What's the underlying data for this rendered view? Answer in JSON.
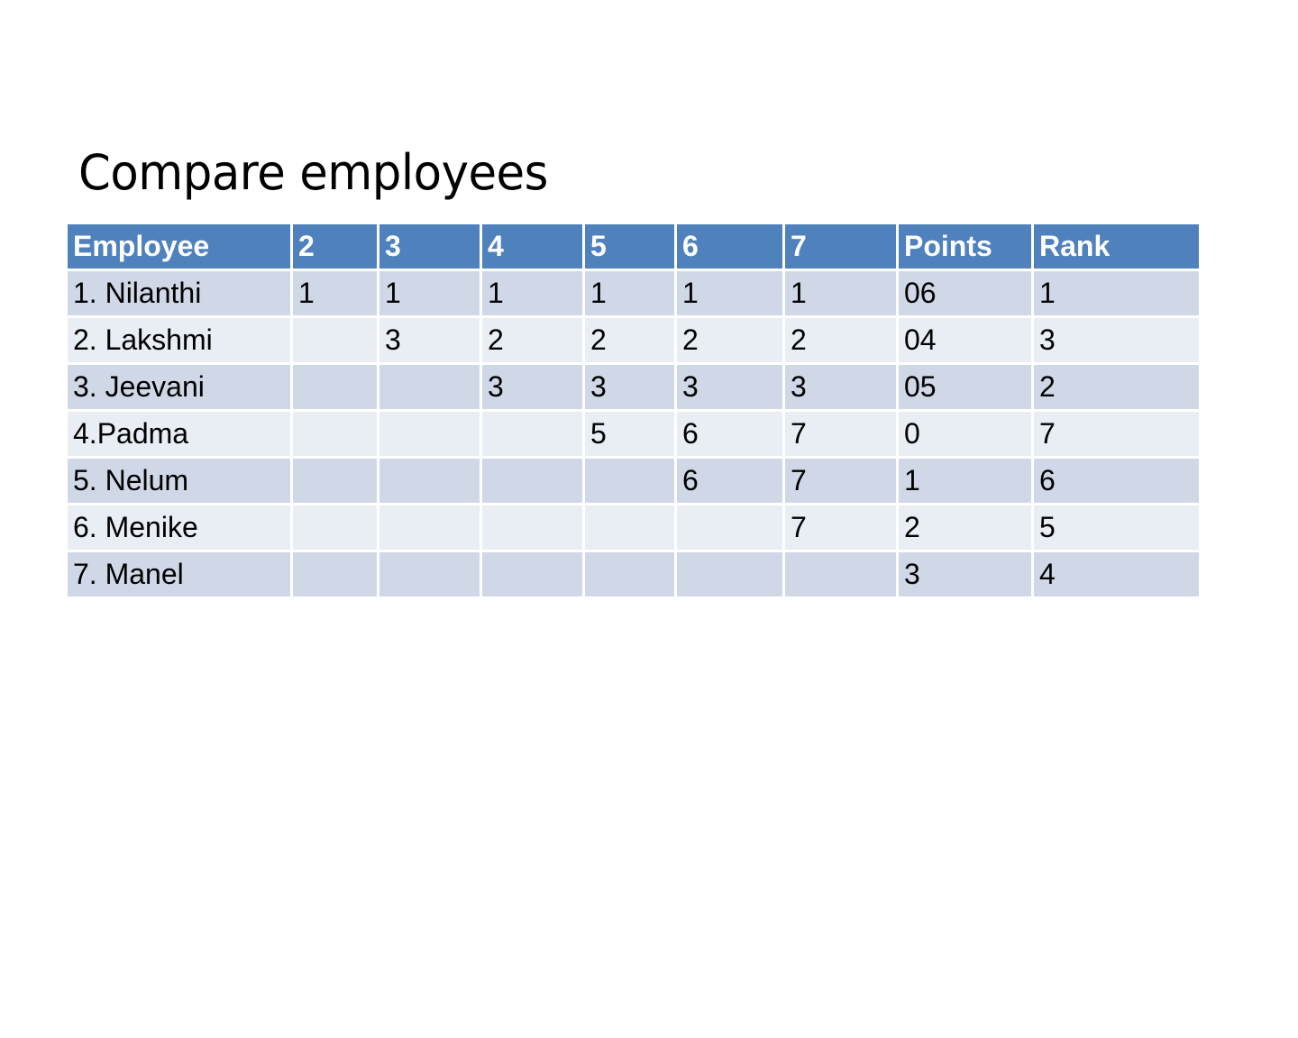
{
  "title": "Compare employees",
  "table": {
    "headers": [
      "Employee",
      "2",
      "3",
      "4",
      "5",
      "6",
      "7",
      "Points",
      "Rank"
    ],
    "rows": [
      [
        "1. Nilanthi",
        "1",
        "1",
        "1",
        "1",
        "1",
        "1",
        "06",
        "1"
      ],
      [
        "2. Lakshmi",
        "",
        "3",
        "2",
        "2",
        "2",
        "2",
        "04",
        "3"
      ],
      [
        "3. Jeevani",
        "",
        "",
        "3",
        "3",
        "3",
        "3",
        "05",
        "2"
      ],
      [
        "4.Padma",
        "",
        "",
        "",
        "5",
        "6",
        "7",
        "0",
        "7"
      ],
      [
        "5. Nelum",
        "",
        "",
        "",
        "",
        "6",
        "7",
        "1",
        "6"
      ],
      [
        "6. Menike",
        "",
        "",
        "",
        "",
        "",
        "7",
        "2",
        "5"
      ],
      [
        "7. Manel",
        "",
        "",
        "",
        "",
        "",
        "",
        "3",
        "4"
      ]
    ]
  },
  "colors": {
    "header": "#4f81bd",
    "row_odd": "#d0d8e8",
    "row_even": "#e9edf4"
  }
}
